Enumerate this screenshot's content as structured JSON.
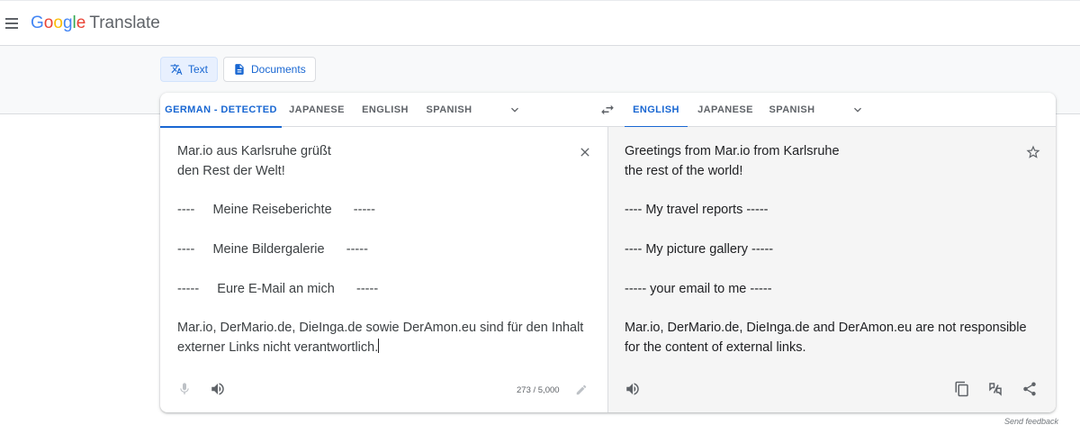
{
  "app": {
    "logo_letters": [
      "G",
      "o",
      "o",
      "g",
      "l",
      "e"
    ],
    "product": "Translate"
  },
  "modes": [
    {
      "label": "Text",
      "icon": "translate-icon",
      "active": true
    },
    {
      "label": "Documents",
      "icon": "document-icon",
      "active": false
    }
  ],
  "source_langs": [
    {
      "label": "GERMAN - DETECTED",
      "active": true
    },
    {
      "label": "JAPANESE",
      "active": false
    },
    {
      "label": "ENGLISH",
      "active": false
    },
    {
      "label": "SPANISH",
      "active": false
    }
  ],
  "target_langs": [
    {
      "label": "ENGLISH",
      "active": true
    },
    {
      "label": "JAPANESE",
      "active": false
    },
    {
      "label": "SPANISH",
      "active": false
    }
  ],
  "source": {
    "text": "Mar.io aus Karlsruhe grüßt\nden Rest der Welt!\n\n----     Meine Reiseberichte      -----\n\n----     Meine Bildergalerie      -----\n\n-----     Eure E-Mail an mich      -----\n\nMar.io, DerMario.de, DieInga.de sowie DerAmon.eu sind für den Inhalt\nexterner Links nicht verantwortlich.",
    "char_count": "273 / 5,000"
  },
  "target": {
    "text": "Greetings from Mar.io from Karlsruhe\nthe rest of the world!\n\n---- My travel reports -----\n\n---- My picture gallery -----\n\n----- your email to me -----\n\nMar.io, DerMario.de, DieInga.de and DerAmon.eu are not responsible\nfor the content of external links."
  },
  "footer": {
    "feedback": "Send feedback"
  },
  "colors": {
    "accent": "#1967d2",
    "active_bg": "#e8f0fe",
    "target_bg": "#f5f5f5"
  }
}
